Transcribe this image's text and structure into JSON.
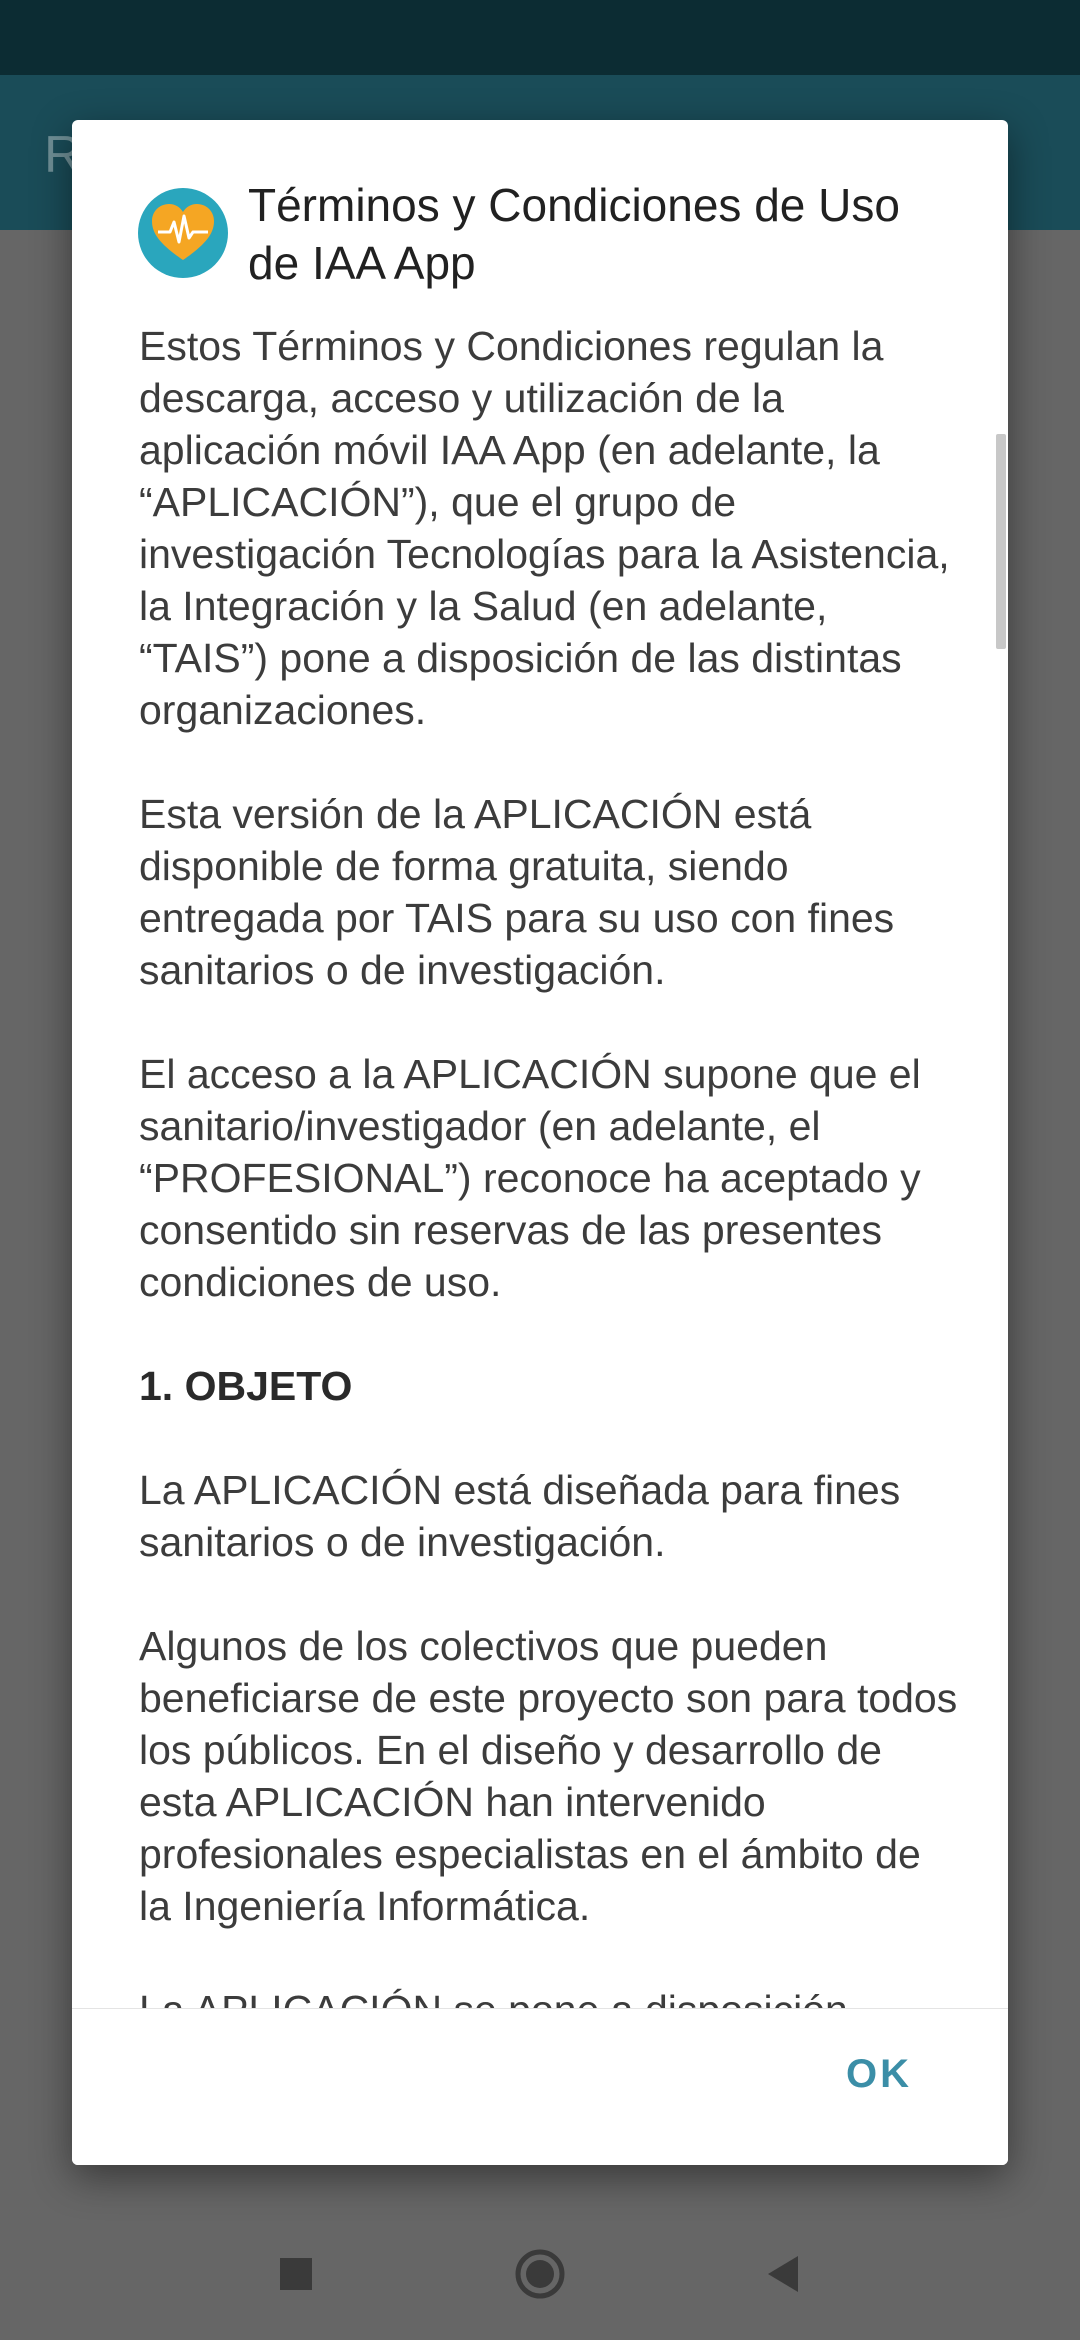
{
  "app_bar": {
    "title_partial": "R"
  },
  "dialog": {
    "title": "Términos y Condiciones de Uso de IAA App",
    "paragraphs": [
      "Estos Términos y Condiciones regulan la descarga, acceso y utilización de la aplicación móvil IAA App (en adelante, la “APLICACIÓN”), que el grupo de investigación Tecnologías para la Asistencia, la Integración y la Salud (en adelante, “TAIS”) pone a disposición de las distintas organizaciones.",
      "Esta versión de la APLICACIÓN está disponible de forma gratuita, siendo entregada por TAIS para su uso con fines sanitarios o de investigación.",
      "El acceso a la APLICACIÓN supone que el sanitario/investigador (en adelante, el “PROFESIONAL”) reconoce ha aceptado y consentido sin reservas de las presentes condiciones de uso.",
      "1. OBJETO",
      "La APLICACIÓN está diseñada para fines sanitarios o de investigación.",
      "Algunos de los colectivos que pueden beneficiarse de este proyecto son para todos los públicos. En el diseño y desarrollo de esta APLICACIÓN han intervenido profesionales especialistas en el ámbito de la Ingeniería Informática.",
      "La APLICACIÓN se pone a disposición"
    ],
    "ok_label": "OK"
  },
  "colors": {
    "status_bar": "#0c2c33",
    "app_bar": "#1a4c58",
    "scrim": "#666666",
    "accent": "#3b8ea7",
    "icon_bg": "#2aa6bd",
    "icon_heart": "#f5a623"
  },
  "icons": {
    "app": "heart-pulse-icon",
    "nav_recent": "square-icon",
    "nav_home": "circle-icon",
    "nav_back": "triangle-back-icon"
  }
}
